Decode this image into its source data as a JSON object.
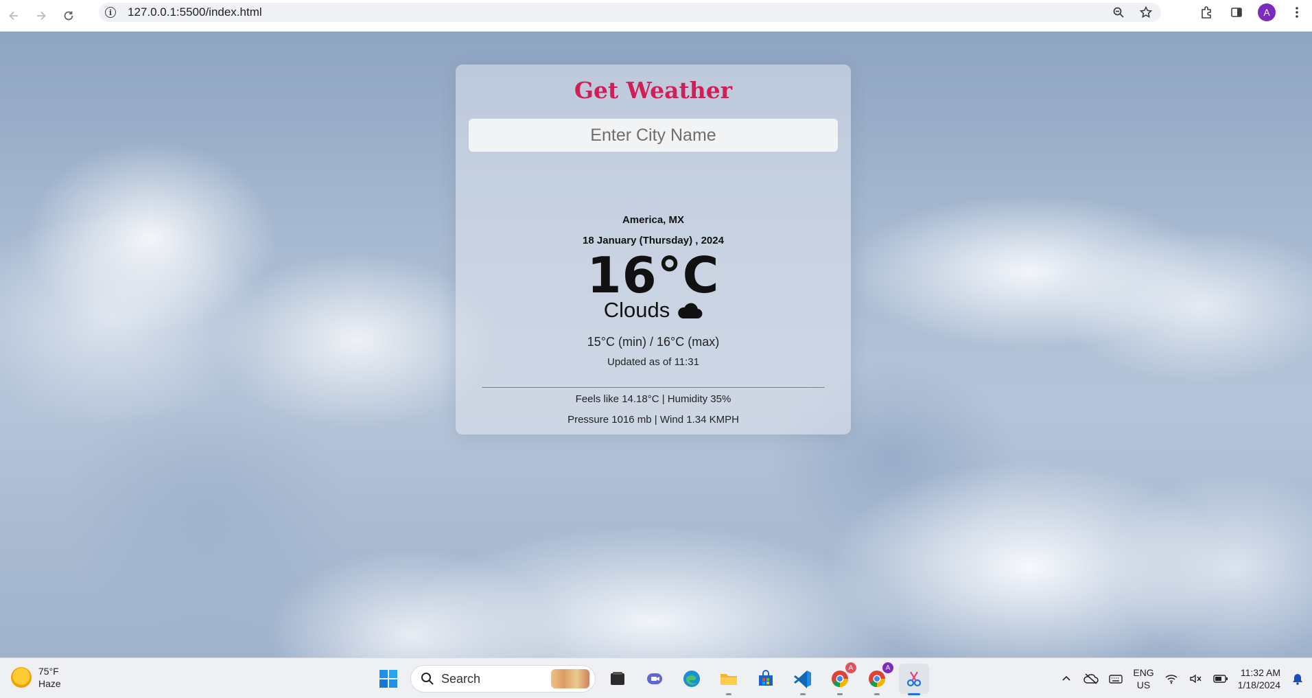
{
  "browser": {
    "url": "127.0.0.1:5500/index.html",
    "profile_initial": "A",
    "profile_color": "#7b2cbf"
  },
  "app": {
    "title": "Get Weather",
    "title_color": "#d01f56",
    "search": {
      "placeholder": "Enter City Name",
      "value": ""
    },
    "location": "America, MX",
    "date": "18 January (Thursday) , 2024",
    "temperature": "16°C",
    "condition": "Clouds",
    "condition_icon": "cloud-icon",
    "minmax": "15°C (min) / 16°C (max)",
    "updated": "Updated as of 11:31",
    "feels_humidity": "Feels like 14.18°C | Humidity 35%",
    "pressure_wind": "Pressure 1016 mb | Wind 1.34 KMPH"
  },
  "taskbar": {
    "weather_temp": "75°F",
    "weather_desc": "Haze",
    "search_label": "Search",
    "lang_line1": "ENG",
    "lang_line2": "US",
    "time": "11:32 AM",
    "date": "1/18/2024"
  }
}
